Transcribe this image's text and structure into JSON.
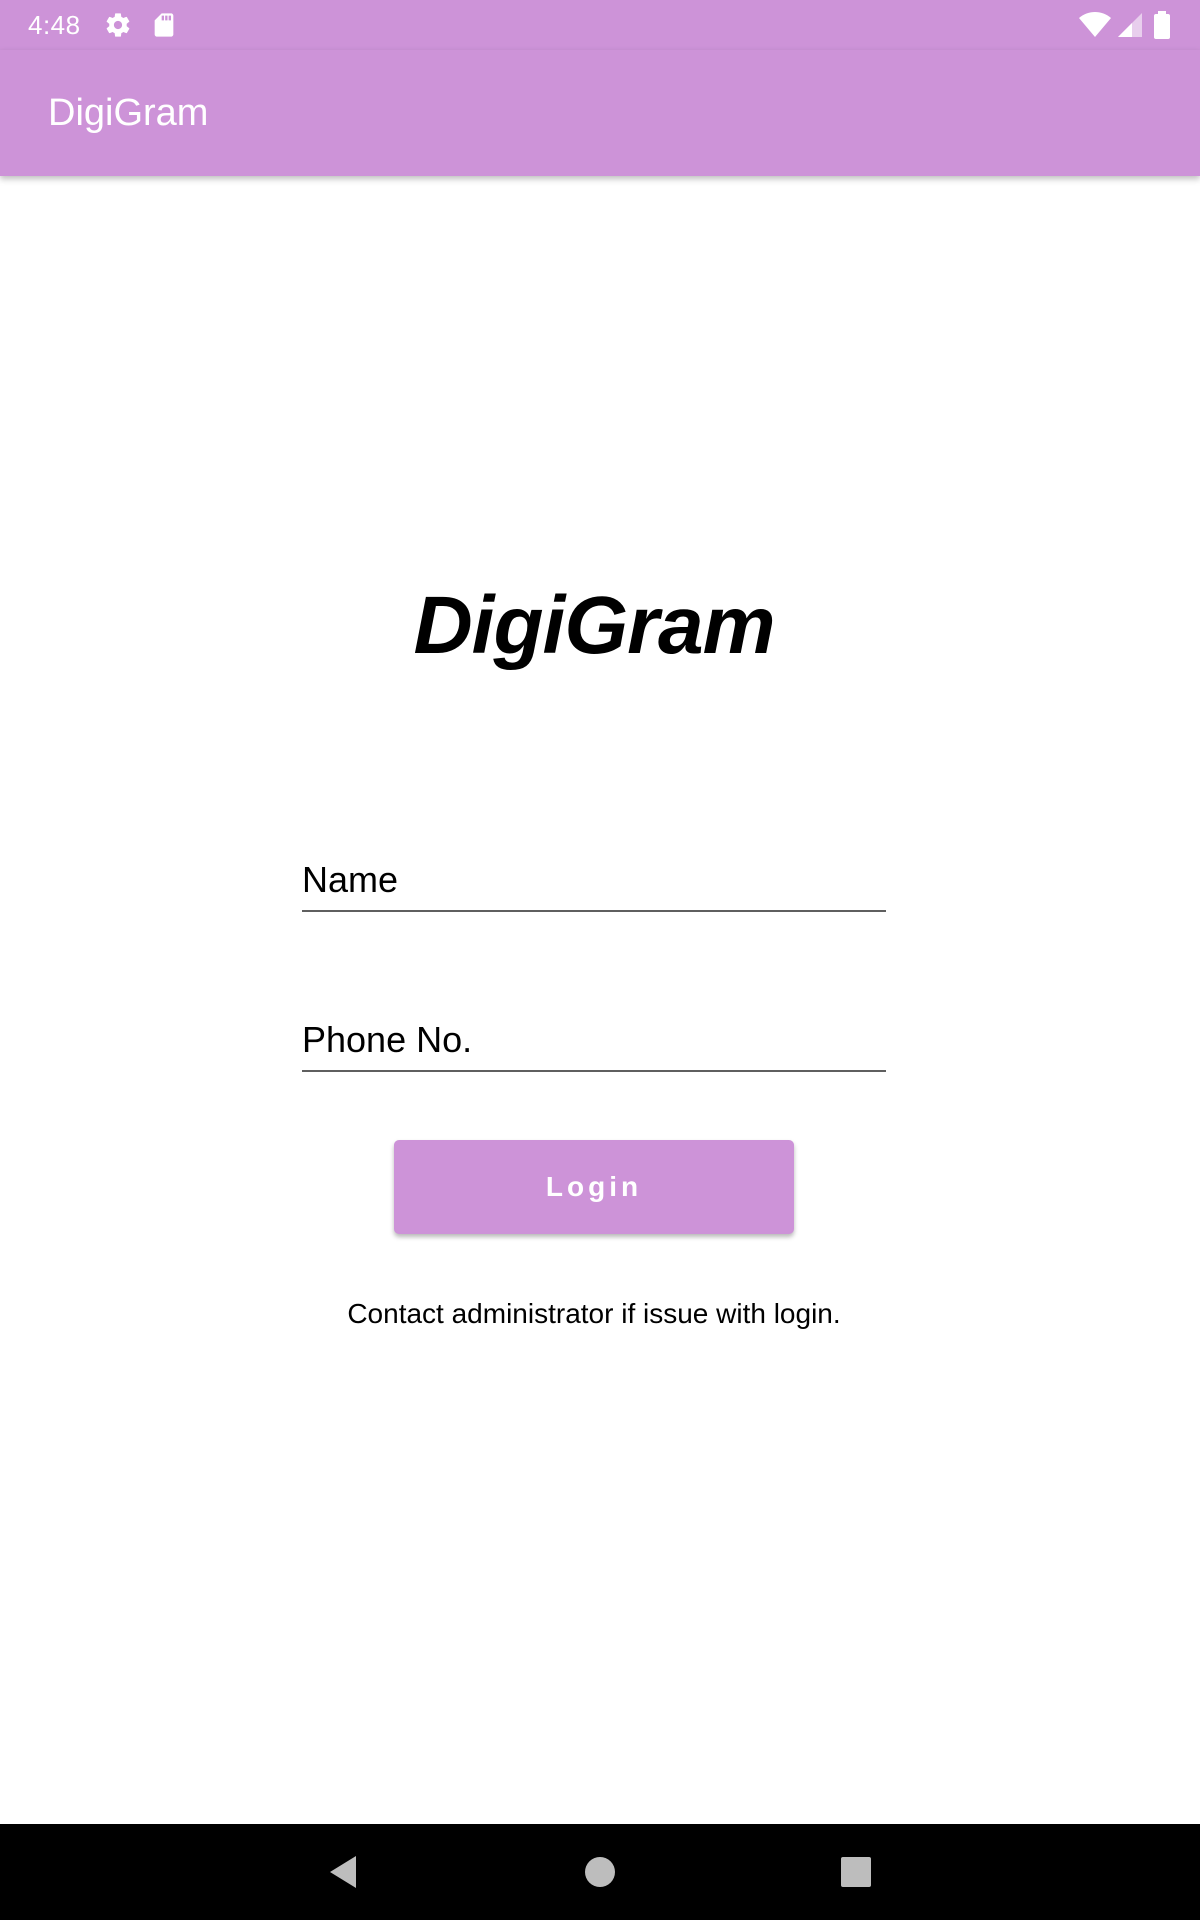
{
  "status_bar": {
    "time": "4:48",
    "left_icons": [
      "gear-icon",
      "sd-card-icon"
    ],
    "right_icons": [
      "wifi-icon",
      "cell-signal-icon",
      "battery-icon"
    ]
  },
  "app_bar": {
    "title": "DigiGram"
  },
  "logo": {
    "text": "DigiGram"
  },
  "form": {
    "name_field": {
      "placeholder": "Name",
      "value": ""
    },
    "phone_field": {
      "placeholder": "Phone No.",
      "value": ""
    },
    "login_button_label": "Login",
    "help_text": "Contact administrator if issue with login."
  },
  "nav_bar": {
    "buttons": [
      "back-icon",
      "home-icon",
      "recents-icon"
    ]
  },
  "colors": {
    "accent": "#cd93d8",
    "text": "#000000",
    "background": "#ffffff",
    "nav_background": "#000000"
  }
}
